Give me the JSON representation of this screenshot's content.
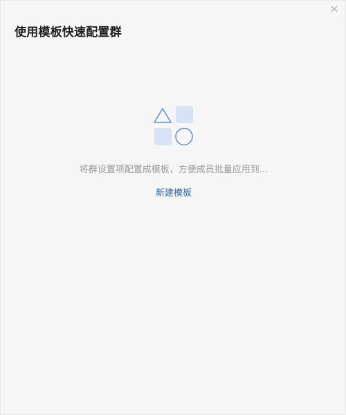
{
  "dialog": {
    "title": "使用模板快速配置群",
    "close_icon": "close-icon"
  },
  "empty_state": {
    "illustration_icon": "shapes-icon",
    "description": "将群设置项配置成模板，方便成员批量应用到...",
    "action_label": "新建模板"
  },
  "colors": {
    "accent": "#2f65a7",
    "shape_outline": "#5b8fd0",
    "shape_fill": "#d6e3f7"
  }
}
